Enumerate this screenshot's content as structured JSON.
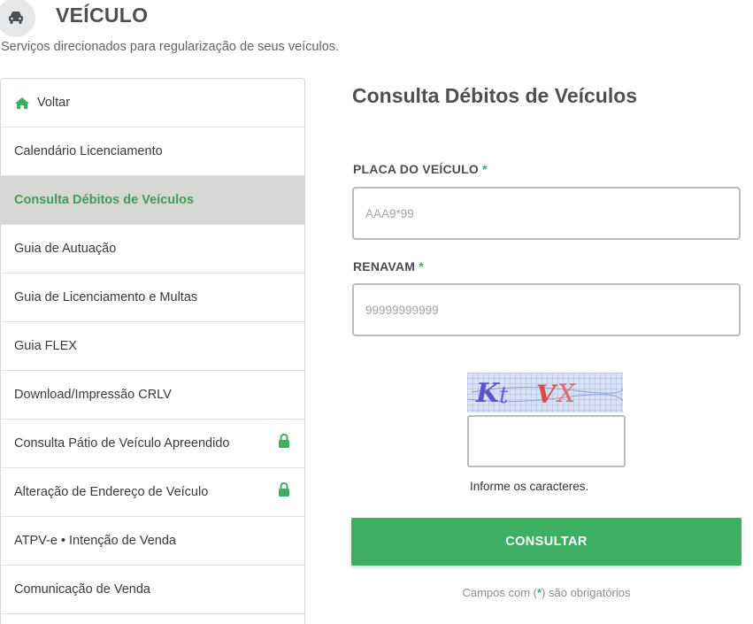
{
  "header": {
    "icon": "car-icon",
    "title": "VEÍCULO",
    "subtitle": "Serviços direcionados para regularização de seus veículos."
  },
  "sidebar": {
    "items": [
      {
        "label": "Voltar",
        "icon": "home-icon"
      },
      {
        "label": "Calendário Licenciamento"
      },
      {
        "label": "Consulta Débitos de Veículos",
        "active": true
      },
      {
        "label": "Guia de Autuação"
      },
      {
        "label": "Guia de Licenciamento e Multas"
      },
      {
        "label": "Guia FLEX"
      },
      {
        "label": "Download/Impressão CRLV"
      },
      {
        "label": "Consulta Pátio de Veículo Apreendido",
        "icon": "lock-icon"
      },
      {
        "label": "Alteração de Endereço de Veículo",
        "icon": "lock-icon"
      },
      {
        "label": "ATPV-e • Intenção de Venda"
      },
      {
        "label": "Comunicação de Venda"
      }
    ]
  },
  "form": {
    "title": "Consulta Débitos de Veículos",
    "placa": {
      "label": "PLACA DO VEÍCULO",
      "required_mark": "*",
      "placeholder": "AAA9*99",
      "value": ""
    },
    "renavam": {
      "label": "RENAVAM",
      "required_mark": "*",
      "placeholder": "99999999999",
      "value": ""
    },
    "captcha": {
      "text": "KtVX",
      "hint": "Informe os caracteres.",
      "value": ""
    },
    "submit_label": "CONSULTAR",
    "footnote": {
      "prefix": "Campos com (",
      "mark": "*",
      "suffix": ") são obrigatórios"
    }
  },
  "colors": {
    "accent": "#3eae63",
    "active_bg": "#d6d8d6",
    "active_text": "#3e9c5a",
    "heading": "#4c5053"
  }
}
